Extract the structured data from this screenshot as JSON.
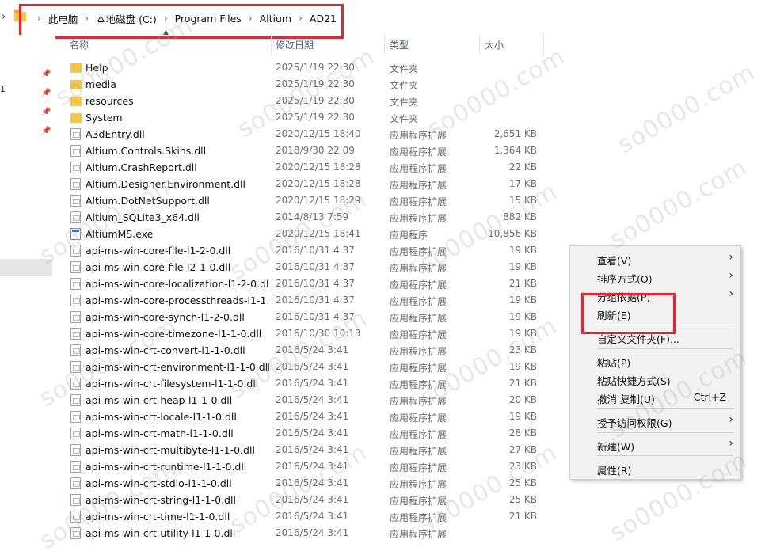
{
  "breadcrumb": [
    "此电脑",
    "本地磁盘 (C:)",
    "Program Files",
    "Altium",
    "AD21"
  ],
  "columns": {
    "name": "名称",
    "date": "修改日期",
    "type": "类型",
    "size": "大小"
  },
  "files": [
    {
      "name": "Help",
      "date": "2025/1/19 22:30",
      "type": "文件夹",
      "size": "",
      "kind": "folder"
    },
    {
      "name": "media",
      "date": "2025/1/19 22:30",
      "type": "文件夹",
      "size": "",
      "kind": "folder"
    },
    {
      "name": "resources",
      "date": "2025/1/19 22:30",
      "type": "文件夹",
      "size": "",
      "kind": "folder"
    },
    {
      "name": "System",
      "date": "2025/1/19 22:30",
      "type": "文件夹",
      "size": "",
      "kind": "folder"
    },
    {
      "name": "A3dEntry.dll",
      "date": "2020/12/15 18:40",
      "type": "应用程序扩展",
      "size": "2,651 KB",
      "kind": "dll"
    },
    {
      "name": "Altium.Controls.Skins.dll",
      "date": "2018/9/30 22:09",
      "type": "应用程序扩展",
      "size": "1,364 KB",
      "kind": "dll"
    },
    {
      "name": "Altium.CrashReport.dll",
      "date": "2020/12/15 18:28",
      "type": "应用程序扩展",
      "size": "22 KB",
      "kind": "dll"
    },
    {
      "name": "Altium.Designer.Environment.dll",
      "date": "2020/12/15 18:28",
      "type": "应用程序扩展",
      "size": "17 KB",
      "kind": "dll"
    },
    {
      "name": "Altium.DotNetSupport.dll",
      "date": "2020/12/15 18:29",
      "type": "应用程序扩展",
      "size": "15 KB",
      "kind": "dll"
    },
    {
      "name": "Altium_SQLite3_x64.dll",
      "date": "2014/8/13 7:59",
      "type": "应用程序扩展",
      "size": "882 KB",
      "kind": "dll"
    },
    {
      "name": "AltiumMS.exe",
      "date": "2020/12/15 18:41",
      "type": "应用程序",
      "size": "10,856 KB",
      "kind": "exe"
    },
    {
      "name": "api-ms-win-core-file-l1-2-0.dll",
      "date": "2016/10/31 4:37",
      "type": "应用程序扩展",
      "size": "19 KB",
      "kind": "dll"
    },
    {
      "name": "api-ms-win-core-file-l2-1-0.dll",
      "date": "2016/10/31 4:37",
      "type": "应用程序扩展",
      "size": "19 KB",
      "kind": "dll"
    },
    {
      "name": "api-ms-win-core-localization-l1-2-0.dll",
      "date": "2016/10/31 4:37",
      "type": "应用程序扩展",
      "size": "21 KB",
      "kind": "dll"
    },
    {
      "name": "api-ms-win-core-processthreads-l1-1...",
      "date": "2016/10/31 4:37",
      "type": "应用程序扩展",
      "size": "19 KB",
      "kind": "dll"
    },
    {
      "name": "api-ms-win-core-synch-l1-2-0.dll",
      "date": "2016/10/31 4:37",
      "type": "应用程序扩展",
      "size": "19 KB",
      "kind": "dll"
    },
    {
      "name": "api-ms-win-core-timezone-l1-1-0.dll",
      "date": "2016/10/30 10:13",
      "type": "应用程序扩展",
      "size": "19 KB",
      "kind": "dll"
    },
    {
      "name": "api-ms-win-crt-convert-l1-1-0.dll",
      "date": "2016/5/24 3:41",
      "type": "应用程序扩展",
      "size": "23 KB",
      "kind": "dll"
    },
    {
      "name": "api-ms-win-crt-environment-l1-1-0.dll",
      "date": "2016/5/24 3:41",
      "type": "应用程序扩展",
      "size": "19 KB",
      "kind": "dll"
    },
    {
      "name": "api-ms-win-crt-filesystem-l1-1-0.dll",
      "date": "2016/5/24 3:41",
      "type": "应用程序扩展",
      "size": "21 KB",
      "kind": "dll"
    },
    {
      "name": "api-ms-win-crt-heap-l1-1-0.dll",
      "date": "2016/5/24 3:41",
      "type": "应用程序扩展",
      "size": "20 KB",
      "kind": "dll"
    },
    {
      "name": "api-ms-win-crt-locale-l1-1-0.dll",
      "date": "2016/5/24 3:41",
      "type": "应用程序扩展",
      "size": "19 KB",
      "kind": "dll"
    },
    {
      "name": "api-ms-win-crt-math-l1-1-0.dll",
      "date": "2016/5/24 3:41",
      "type": "应用程序扩展",
      "size": "28 KB",
      "kind": "dll"
    },
    {
      "name": "api-ms-win-crt-multibyte-l1-1-0.dll",
      "date": "2016/5/24 3:41",
      "type": "应用程序扩展",
      "size": "27 KB",
      "kind": "dll"
    },
    {
      "name": "api-ms-win-crt-runtime-l1-1-0.dll",
      "date": "2016/5/24 3:41",
      "type": "应用程序扩展",
      "size": "23 KB",
      "kind": "dll"
    },
    {
      "name": "api-ms-win-crt-stdio-l1-1-0.dll",
      "date": "2016/5/24 3:41",
      "type": "应用程序扩展",
      "size": "25 KB",
      "kind": "dll"
    },
    {
      "name": "api-ms-win-crt-string-l1-1-0.dll",
      "date": "2016/5/24 3:41",
      "type": "应用程序扩展",
      "size": "25 KB",
      "kind": "dll"
    },
    {
      "name": "api-ms-win-crt-time-l1-1-0.dll",
      "date": "2016/5/24 3:41",
      "type": "应用程序扩展",
      "size": "21 KB",
      "kind": "dll"
    },
    {
      "name": "api-ms-win-crt-utility-l1-1-0.dll",
      "date": "2016/5/24 3:41",
      "type": "应用程序扩展",
      "size": "",
      "kind": "dll"
    }
  ],
  "context_menu": {
    "view": "查看(V)",
    "sort": "排序方式(O)",
    "group": "分组依据(P)",
    "refresh": "刷新(E)",
    "customize": "自定义文件夹(F)...",
    "paste": "粘贴(P)",
    "paste_shortcut": "粘贴快捷方式(S)",
    "undo": "撤消 复制(U)",
    "undo_shortcut": "Ctrl+Z",
    "access": "授予访问权限(G)",
    "new": "新建(W)",
    "properties": "属性(R)"
  },
  "nav": {
    "drive_letter": "1"
  },
  "watermark": "so0000.com",
  "colors": {
    "highlight": "#e8242e",
    "menu_bg": "#f2f2f2",
    "folder": "#f3c548"
  }
}
